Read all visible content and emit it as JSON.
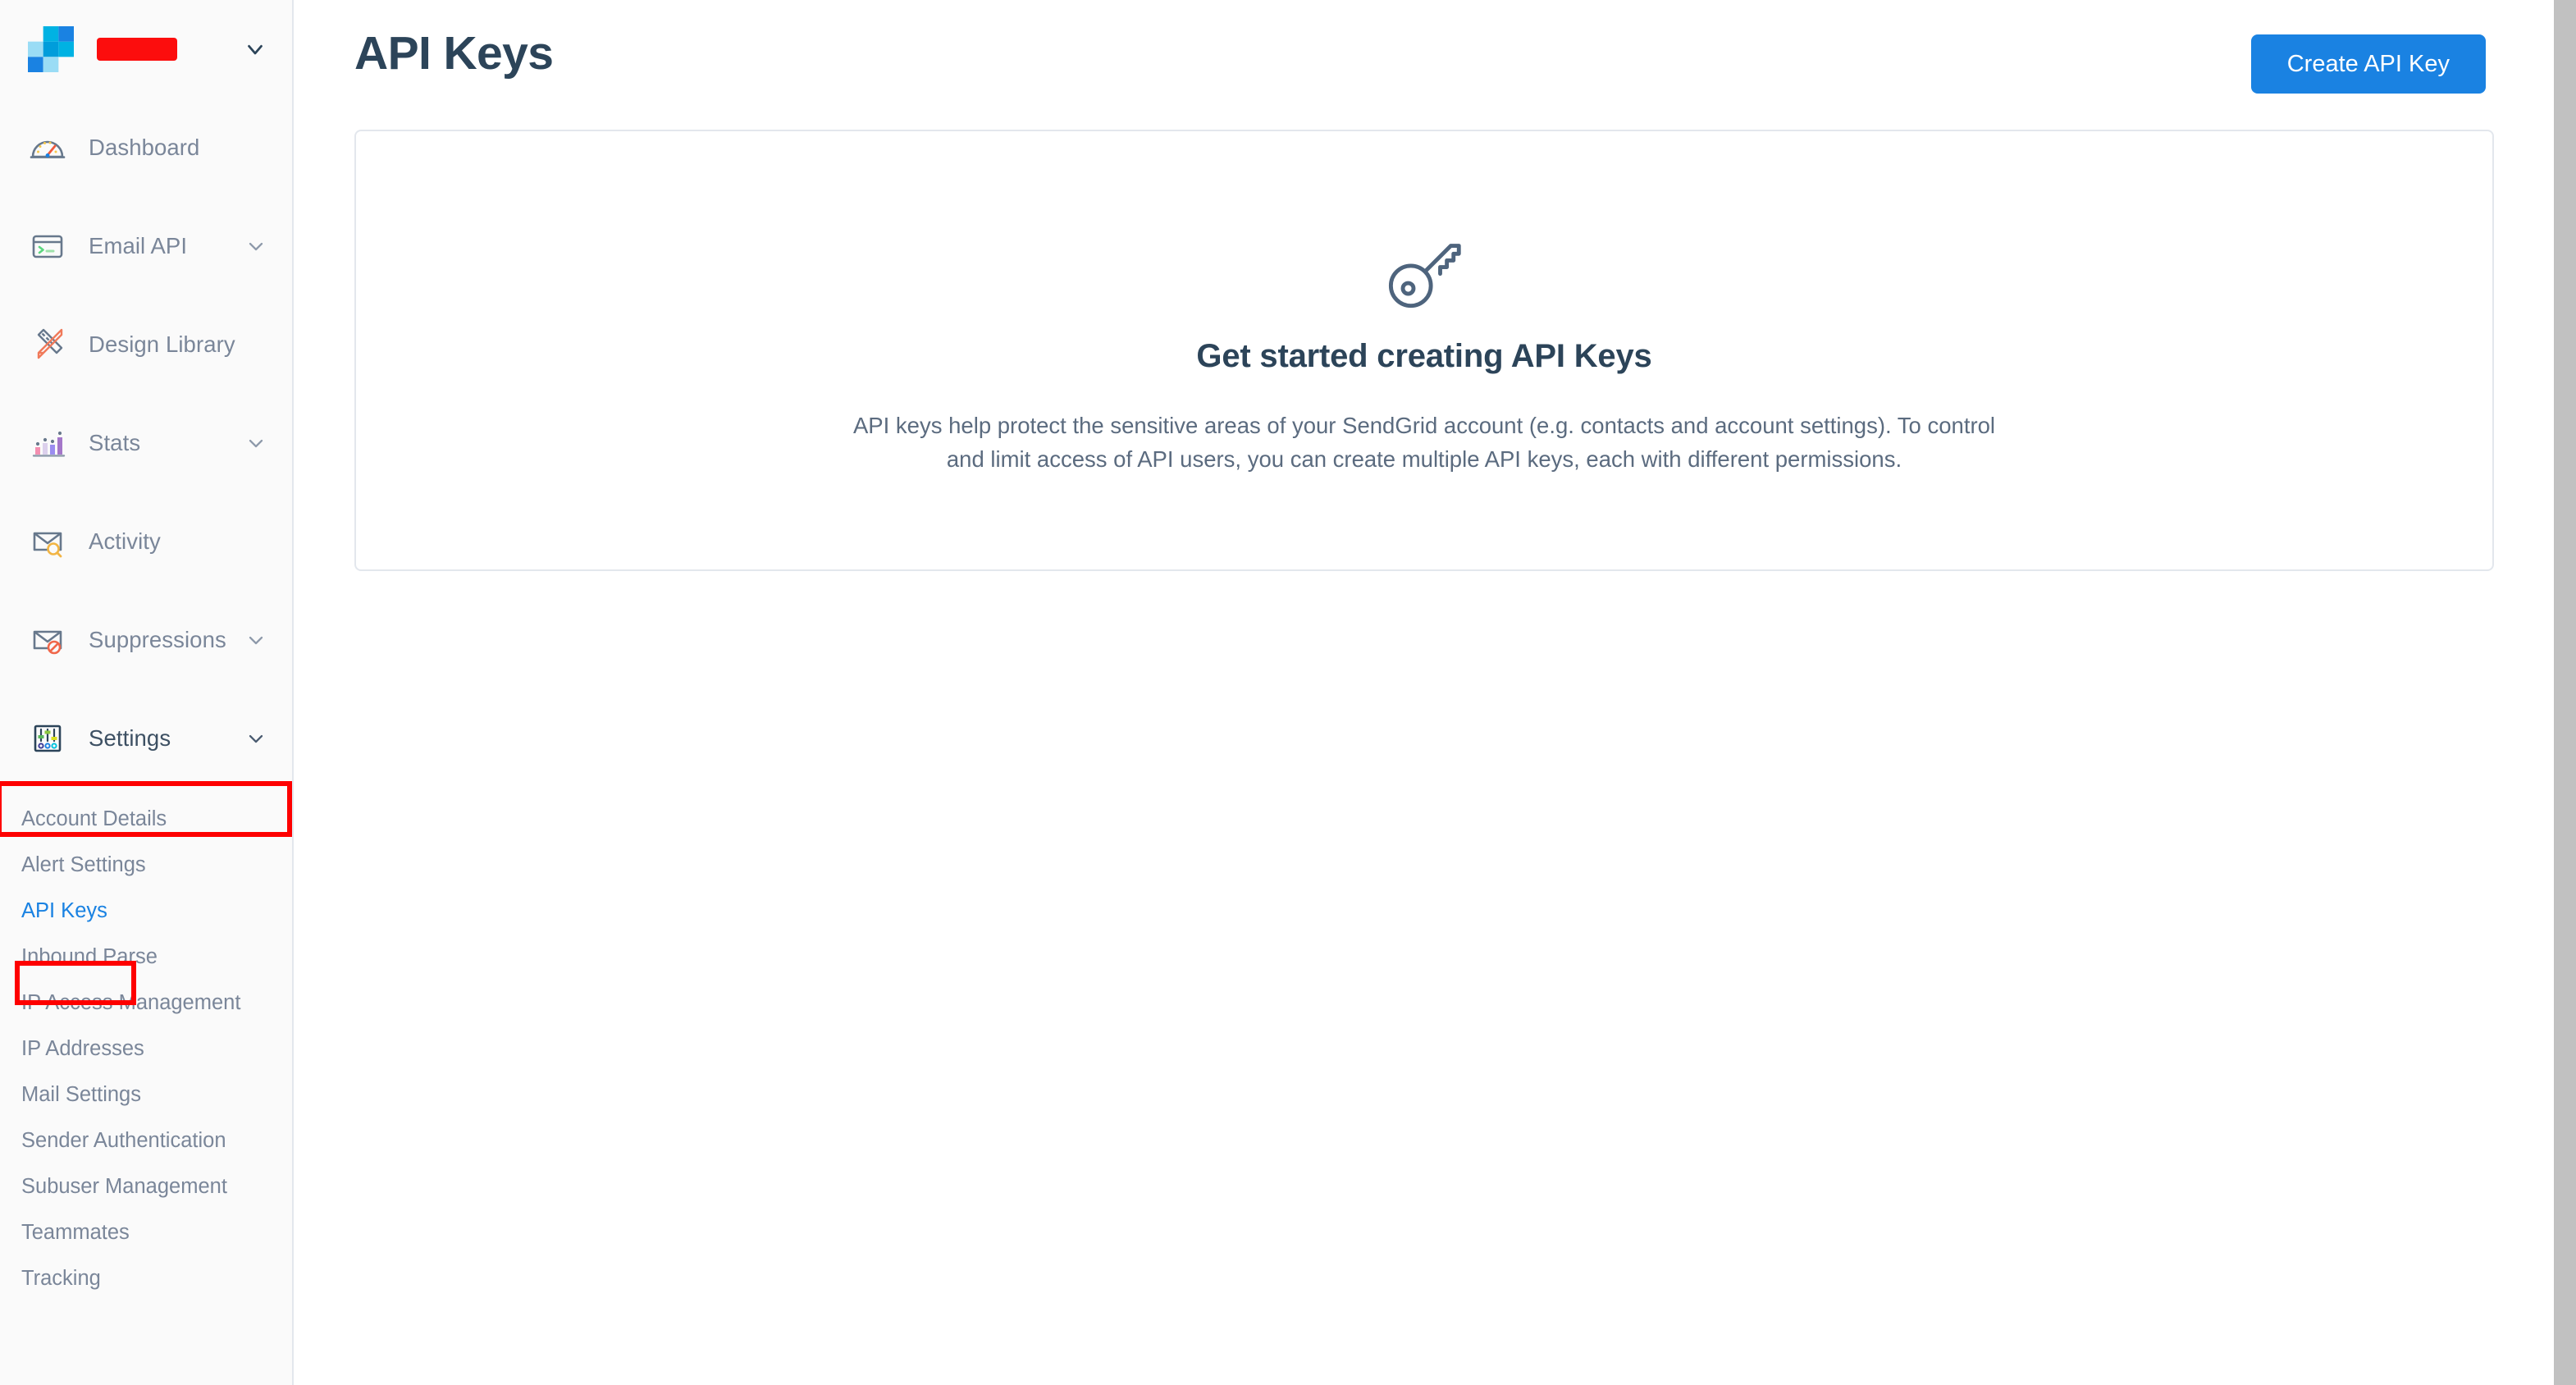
{
  "sidebar": {
    "brand": {
      "logo_icon": "sendgrid-logo-icon",
      "account_name_redacted": "",
      "caret_icon": "chevron-down-icon"
    },
    "items": [
      {
        "label": "Dashboard",
        "icon": "speedometer-icon",
        "has_caret": false
      },
      {
        "label": "Email API",
        "icon": "terminal-icon",
        "has_caret": true
      },
      {
        "label": "Design Library",
        "icon": "pencil-ruler-icon",
        "has_caret": false
      },
      {
        "label": "Stats",
        "icon": "bar-chart-icon",
        "has_caret": true
      },
      {
        "label": "Activity",
        "icon": "envelope-search-icon",
        "has_caret": false
      },
      {
        "label": "Suppressions",
        "icon": "envelope-block-icon",
        "has_caret": true
      },
      {
        "label": "Settings",
        "icon": "sliders-icon",
        "has_caret": true
      }
    ],
    "submenu": [
      {
        "label": "Account Details",
        "active": false
      },
      {
        "label": "Alert Settings",
        "active": false
      },
      {
        "label": "API Keys",
        "active": true
      },
      {
        "label": "Inbound Parse",
        "active": false
      },
      {
        "label": "IP Access Management",
        "active": false
      },
      {
        "label": "IP Addresses",
        "active": false
      },
      {
        "label": "Mail Settings",
        "active": false
      },
      {
        "label": "Sender Authentication",
        "active": false
      },
      {
        "label": "Subuser Management",
        "active": false
      },
      {
        "label": "Teammates",
        "active": false
      },
      {
        "label": "Tracking",
        "active": false
      }
    ]
  },
  "main": {
    "page_title": "API Keys",
    "create_button_label": "Create API Key",
    "empty_state": {
      "icon": "key-icon",
      "title": "Get started creating API Keys",
      "description": "API keys help protect the sensitive areas of your SendGrid account (e.g. contacts and account settings). To control and limit access of API users, you can create multiple API keys, each with different permissions."
    }
  },
  "colors": {
    "accent_blue": "#1a82e2",
    "title_navy": "#2c4459",
    "body_gray": "#5b6b7f",
    "nav_gray": "#7a8699",
    "sidebar_bg": "#fafafa",
    "border": "#e3e7ed",
    "annotation_red": "#fe0000",
    "redaction_red": "#fc0d0d"
  },
  "annotations": [
    {
      "name": "settings-highlight",
      "target": "Settings"
    },
    {
      "name": "api-keys-highlight",
      "target": "API Keys"
    }
  ]
}
